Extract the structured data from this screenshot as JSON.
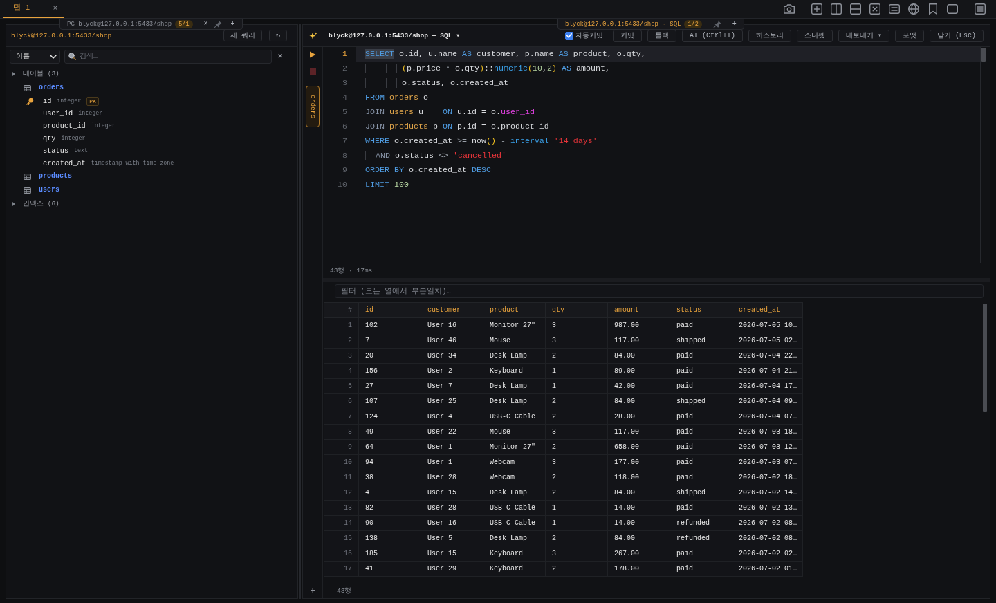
{
  "tabs": [
    {
      "label": "탭 1",
      "close": "×",
      "selected": true
    }
  ],
  "floating_tabs": [
    {
      "label": "PG blyck@127.0.0.1:5433/shop",
      "badge": "5/1",
      "close": "×",
      "add": "+",
      "selected": false
    },
    {
      "label": "blyck@127.0.0.1:5433/shop · SQL",
      "badge": "1/2",
      "add": "+",
      "selected": true
    }
  ],
  "sidebar": {
    "connection": "blyck@127.0.0.1:5433/shop",
    "new_query": "새 쿼리",
    "refresh": "↻",
    "sort_select": "이름",
    "search": {
      "placeholder": "검색…"
    },
    "clear": "×",
    "tree": [
      {
        "label": "테이블 (3)",
        "kind": "group",
        "children": [
          {
            "label": "orders",
            "kind": "table",
            "children": [
              {
                "label": "id",
                "kind": "column",
                "type": "integer",
                "primary_key": true,
                "badge": "PK"
              },
              {
                "label": "user_id",
                "kind": "column",
                "type": "integer",
                "primary_key": false
              },
              {
                "label": "product_id",
                "kind": "column",
                "type": "integer",
                "primary_key": false
              },
              {
                "label": "qty",
                "kind": "column",
                "type": "integer",
                "primary_key": false
              },
              {
                "label": "status",
                "kind": "column",
                "type": "text",
                "primary_key": false
              },
              {
                "label": "created_at",
                "kind": "column",
                "type": "timestamp with time zone",
                "primary_key": false
              }
            ]
          },
          {
            "label": "products",
            "kind": "table"
          },
          {
            "label": "users",
            "kind": "table"
          }
        ]
      },
      {
        "label": "인덱스 (6)",
        "kind": "group"
      }
    ]
  },
  "editor": {
    "title": "blyck@127.0.0.1:5433/shop — SQL ▾",
    "toolbar": [
      {
        "kind": "checkbox",
        "label": "자동커밋",
        "checked": true
      },
      {
        "kind": "button",
        "label": "커밋"
      },
      {
        "kind": "button",
        "label": "롤백"
      },
      {
        "kind": "button",
        "label": "AI (Ctrl+I)"
      },
      {
        "kind": "button",
        "label": "히스토리"
      },
      {
        "kind": "button",
        "label": "스니펫"
      },
      {
        "kind": "button",
        "label": "내보내기 ▾"
      },
      {
        "kind": "button",
        "label": "포맷"
      },
      {
        "kind": "button",
        "label": "닫기 (Esc)"
      }
    ],
    "side_tab": "orders",
    "add": "+",
    "lines": [
      {
        "number": "1",
        "current": true,
        "tokens": [
          {
            "kind": "match",
            "text": "SELECT"
          },
          {
            "kind": "plain",
            "text": " o.id, u.name "
          },
          {
            "kind": "keyword",
            "text": "AS"
          },
          {
            "kind": "plain",
            "text": " customer, p.name "
          },
          {
            "kind": "keyword",
            "text": "AS"
          },
          {
            "kind": "plain",
            "text": " product, o.qty,"
          }
        ]
      },
      {
        "number": "2",
        "current": false,
        "tokens": [
          {
            "kind": "paren",
            "text": "       ("
          },
          {
            "kind": "plain",
            "text": "p.price "
          },
          {
            "kind": "operator",
            "text": "*"
          },
          {
            "kind": "plain",
            "text": " o.qty"
          },
          {
            "kind": "paren",
            "text": ")"
          },
          {
            "kind": "plain",
            "text": "::"
          },
          {
            "kind": "type",
            "text": "numeric"
          },
          {
            "kind": "paren",
            "text": "("
          },
          {
            "kind": "number",
            "text": "10"
          },
          {
            "kind": "plain",
            "text": ","
          },
          {
            "kind": "number",
            "text": "2"
          },
          {
            "kind": "paren",
            "text": ")"
          },
          {
            "kind": "keyword",
            "text": " AS"
          },
          {
            "kind": "plain",
            "text": " amount,"
          }
        ]
      },
      {
        "number": "3",
        "current": false,
        "tokens": [
          {
            "kind": "plain",
            "text": "       o.status, o.created_at"
          }
        ]
      },
      {
        "number": "4",
        "current": false,
        "tokens": [
          {
            "kind": "keyword",
            "text": "FROM"
          },
          {
            "kind": "table",
            "text": " orders"
          },
          {
            "kind": "plain",
            "text": " o"
          }
        ]
      },
      {
        "number": "5",
        "current": false,
        "tokens": [
          {
            "kind": "join",
            "text": "JOIN"
          },
          {
            "kind": "table",
            "text": " users"
          },
          {
            "kind": "plain",
            "text": " u    "
          },
          {
            "kind": "keyword",
            "text": "ON"
          },
          {
            "kind": "plain",
            "text": " u.id = o."
          },
          {
            "kind": "column",
            "text": "user_id"
          }
        ]
      },
      {
        "number": "6",
        "current": false,
        "tokens": [
          {
            "kind": "join",
            "text": "JOIN"
          },
          {
            "kind": "table",
            "text": " products"
          },
          {
            "kind": "plain",
            "text": " p "
          },
          {
            "kind": "keyword",
            "text": "ON"
          },
          {
            "kind": "plain",
            "text": " p.id = o.product_id"
          }
        ]
      },
      {
        "number": "7",
        "current": false,
        "tokens": [
          {
            "kind": "keyword",
            "text": "WHERE"
          },
          {
            "kind": "plain",
            "text": " o.created_at "
          },
          {
            "kind": "operator",
            "text": ">="
          },
          {
            "kind": "plain",
            "text": " now"
          },
          {
            "kind": "paren",
            "text": "()"
          },
          {
            "kind": "operator",
            "text": " -"
          },
          {
            "kind": "type",
            "text": " interval"
          },
          {
            "kind": "string",
            "text": " '14 days'"
          }
        ]
      },
      {
        "number": "8",
        "current": false,
        "tokens": [
          {
            "kind": "join",
            "text": "  AND"
          },
          {
            "kind": "plain",
            "text": " o.status "
          },
          {
            "kind": "operator",
            "text": "<>"
          },
          {
            "kind": "string",
            "text": " 'cancelled'"
          }
        ]
      },
      {
        "number": "9",
        "current": false,
        "tokens": [
          {
            "kind": "keyword",
            "text": "ORDER BY"
          },
          {
            "kind": "plain",
            "text": " o.created_at "
          },
          {
            "kind": "keyword",
            "text": "DESC"
          }
        ]
      },
      {
        "number": "10",
        "current": false,
        "tokens": [
          {
            "kind": "keyword",
            "text": "LIMIT"
          },
          {
            "kind": "number",
            "text": " 100"
          }
        ]
      }
    ]
  },
  "results": {
    "summary": "43행 · 17ms",
    "filter": {
      "placeholder": "필터 (모든 열에서 부분일치)…"
    },
    "columns": [
      "#",
      "id",
      "customer",
      "product",
      "qty",
      "amount",
      "status",
      "created_at"
    ],
    "rows": [
      [
        "1",
        "102",
        "User 16",
        "Monitor 27\"",
        "3",
        "987.00",
        "paid",
        "2026-07-05 10…"
      ],
      [
        "2",
        "7",
        "User 46",
        "Mouse",
        "3",
        "117.00",
        "shipped",
        "2026-07-05 02…"
      ],
      [
        "3",
        "20",
        "User 34",
        "Desk Lamp",
        "2",
        "84.00",
        "paid",
        "2026-07-04 22…"
      ],
      [
        "4",
        "156",
        "User 2",
        "Keyboard",
        "1",
        "89.00",
        "paid",
        "2026-07-04 21…"
      ],
      [
        "5",
        "27",
        "User 7",
        "Desk Lamp",
        "1",
        "42.00",
        "paid",
        "2026-07-04 17…"
      ],
      [
        "6",
        "107",
        "User 25",
        "Desk Lamp",
        "2",
        "84.00",
        "shipped",
        "2026-07-04 09…"
      ],
      [
        "7",
        "124",
        "User 4",
        "USB-C Cable",
        "2",
        "28.00",
        "paid",
        "2026-07-04 07…"
      ],
      [
        "8",
        "49",
        "User 22",
        "Mouse",
        "3",
        "117.00",
        "paid",
        "2026-07-03 18…"
      ],
      [
        "9",
        "64",
        "User 1",
        "Monitor 27\"",
        "2",
        "658.00",
        "paid",
        "2026-07-03 12…"
      ],
      [
        "10",
        "94",
        "User 1",
        "Webcam",
        "3",
        "177.00",
        "paid",
        "2026-07-03 07…"
      ],
      [
        "11",
        "38",
        "User 28",
        "Webcam",
        "2",
        "118.00",
        "paid",
        "2026-07-02 18…"
      ],
      [
        "12",
        "4",
        "User 15",
        "Desk Lamp",
        "2",
        "84.00",
        "shipped",
        "2026-07-02 14…"
      ],
      [
        "13",
        "82",
        "User 28",
        "USB-C Cable",
        "1",
        "14.00",
        "paid",
        "2026-07-02 13…"
      ],
      [
        "14",
        "90",
        "User 16",
        "USB-C Cable",
        "1",
        "14.00",
        "refunded",
        "2026-07-02 08…"
      ],
      [
        "15",
        "138",
        "User 5",
        "Desk Lamp",
        "2",
        "84.00",
        "refunded",
        "2026-07-02 08…"
      ],
      [
        "16",
        "185",
        "User 15",
        "Keyboard",
        "3",
        "267.00",
        "paid",
        "2026-07-02 02…"
      ],
      [
        "17",
        "41",
        "User 29",
        "Keyboard",
        "2",
        "178.00",
        "paid",
        "2026-07-02 01…"
      ]
    ],
    "row_count": "43행"
  }
}
